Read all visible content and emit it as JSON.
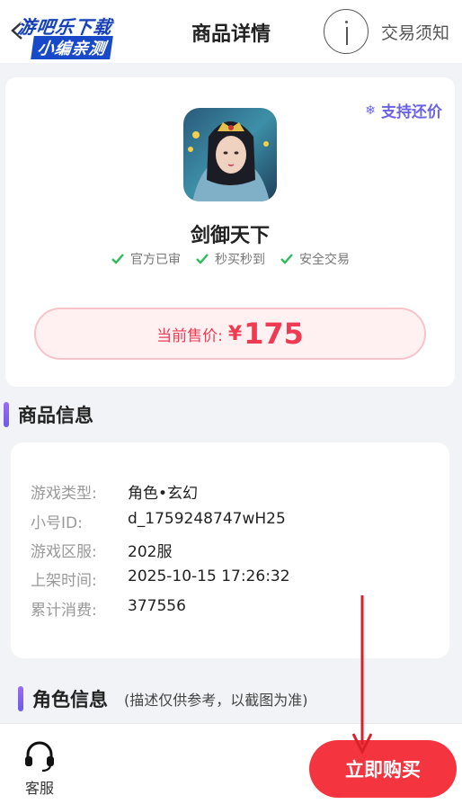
{
  "header": {
    "title": "商品详情",
    "notice_link": "交易须知",
    "watermark_line1": "游吧乐下载",
    "watermark_line2": "小编亲测"
  },
  "product": {
    "bargain_label": "支持还价",
    "game_name": "剑御天下",
    "badges": [
      "官方已审",
      "秒买秒到",
      "安全交易"
    ],
    "price_label": "当前售价:",
    "price_currency": "¥",
    "price_value": "175"
  },
  "product_info": {
    "section_title": "商品信息",
    "rows": [
      {
        "key": "游戏类型:",
        "value": "角色•玄幻"
      },
      {
        "key": "小号ID:",
        "value": "d_1759248747wH25"
      },
      {
        "key": "游戏区服:",
        "value": "202服"
      },
      {
        "key": "上架时间:",
        "value": "2025-10-15 17:26:32"
      },
      {
        "key": "累计消费:",
        "value": "377556"
      }
    ]
  },
  "role_info": {
    "section_title": "角色信息",
    "note": "(描述仅供参考，以截图为准)"
  },
  "bottom": {
    "service_label": "客服",
    "buy_label": "立即购买"
  },
  "colors": {
    "accent_purple": "#6b63e6",
    "price_red": "#ef3b52",
    "buy_red": "#f4343f",
    "check_green": "#2dbb5d"
  }
}
